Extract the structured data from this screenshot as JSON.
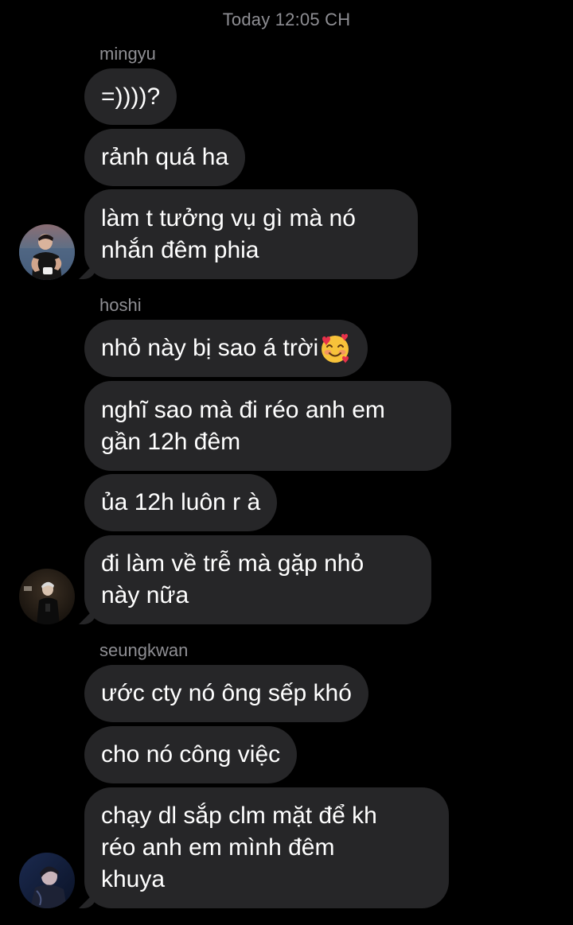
{
  "header": {
    "timestamp": "Today 12:05 CH"
  },
  "groups": [
    {
      "sender": "mingyu",
      "avatar_icon": "user-avatar-mingyu",
      "messages": [
        {
          "text": "=))))?"
        },
        {
          "text": "rảnh quá ha"
        },
        {
          "lines": [
            "làm t tưởng vụ gì mà nó",
            "nhắn đêm phia"
          ]
        }
      ]
    },
    {
      "sender": "hoshi",
      "avatar_icon": "user-avatar-hoshi",
      "messages": [
        {
          "text": "nhỏ này bị sao á trời",
          "emoji": "smiling-face-with-hearts-icon"
        },
        {
          "lines": [
            "nghĩ sao mà đi réo anh em",
            "gần 12h đêm"
          ]
        },
        {
          "text": "ủa 12h luôn r à"
        },
        {
          "lines": [
            "đi làm về trễ mà gặp nhỏ",
            "này nữa"
          ]
        }
      ]
    },
    {
      "sender": "seungkwan",
      "avatar_icon": "user-avatar-seungkwan",
      "messages": [
        {
          "text": "ước cty nó ông sếp khó"
        },
        {
          "text": "cho nó công việc"
        },
        {
          "lines": [
            "chạy dl sắp clm mặt để kh",
            "réo anh em mình đêm",
            "khuya"
          ]
        }
      ]
    }
  ],
  "colors": {
    "background": "#000000",
    "bubble": "#262628",
    "meta_text": "#8e8e93",
    "message_text": "#ffffff"
  }
}
